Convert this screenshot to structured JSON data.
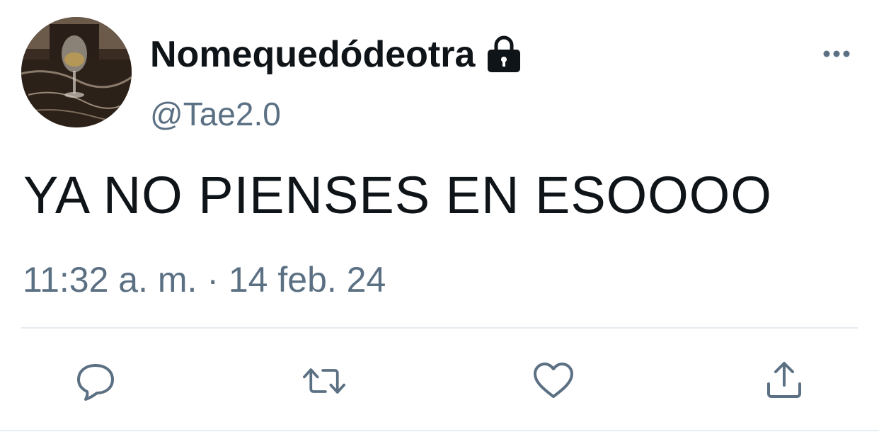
{
  "tweet": {
    "display_name": "Nomequedódeotra",
    "handle": "@Tae2.0",
    "text": "YA NO PIENSES EN ESOOOO",
    "timestamp": "11:32 a. m. · 14 feb. 24",
    "protected_icon": "lock-icon",
    "more_icon": "ellipsis-icon"
  },
  "actions": [
    {
      "name": "reply",
      "icon": "reply-icon"
    },
    {
      "name": "retweet",
      "icon": "retweet-icon"
    },
    {
      "name": "like",
      "icon": "heart-icon"
    },
    {
      "name": "share",
      "icon": "share-icon"
    }
  ],
  "colors": {
    "text": "#0f1419",
    "secondary": "#5b7083",
    "divider": "#e6ecf0"
  }
}
